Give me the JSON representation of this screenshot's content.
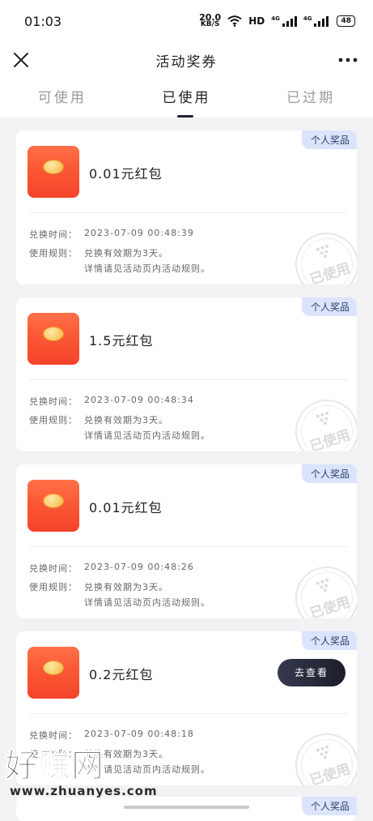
{
  "status_bar": {
    "time": "01:03",
    "net_speed": "20.0",
    "net_unit": "KB/S",
    "hd": "HD",
    "sig1": "4G",
    "sig2": "4G",
    "battery": "48"
  },
  "header": {
    "title": "活动奖券",
    "close_icon": "close-icon",
    "more_icon": "more-icon"
  },
  "tabs": [
    {
      "label": "可使用",
      "active": false
    },
    {
      "label": "已使用",
      "active": true
    },
    {
      "label": "已过期",
      "active": false
    }
  ],
  "cards": [
    {
      "badge": "个人奖品",
      "prize": "0.01元红包",
      "time_label": "兑换时间：",
      "time_value": "2023-07-09 00:48:39",
      "rule_label": "使用规则：",
      "rule_line1": "兑换有效期为3天。",
      "rule_line2": "详情请见活动页内活动规则。",
      "stamp": "已使用"
    },
    {
      "badge": "个人奖品",
      "prize": "1.5元红包",
      "time_label": "兑换时间：",
      "time_value": "2023-07-09 00:48:34",
      "rule_label": "使用规则：",
      "rule_line1": "兑换有效期为3天。",
      "rule_line2": "详情请见活动页内活动规则。",
      "stamp": "已使用"
    },
    {
      "badge": "个人奖品",
      "prize": "0.01元红包",
      "time_label": "兑换时间：",
      "time_value": "2023-07-09 00:48:26",
      "rule_label": "使用规则：",
      "rule_line1": "兑换有效期为3天。",
      "rule_line2": "详情请见活动页内活动规则。",
      "stamp": "已使用"
    },
    {
      "badge": "个人奖品",
      "prize": "0.2元红包",
      "button": "去查看",
      "time_label": "兑换时间：",
      "time_value": "2023-07-09 00:48:18",
      "rule_label": "使用规则：",
      "rule_line1": "兑换有效期为3天。",
      "rule_line2": "详情请见活动页内活动规则。",
      "stamp": "已使用"
    }
  ],
  "partial_card": {
    "badge": "个人奖品"
  },
  "watermark": {
    "text": "好赚网",
    "url": "www.zhuanyes.com"
  },
  "colors": {
    "badge_bg": "#dbe4fb",
    "envelope": "#f5432a",
    "button_bg": "#1b1d2a"
  }
}
